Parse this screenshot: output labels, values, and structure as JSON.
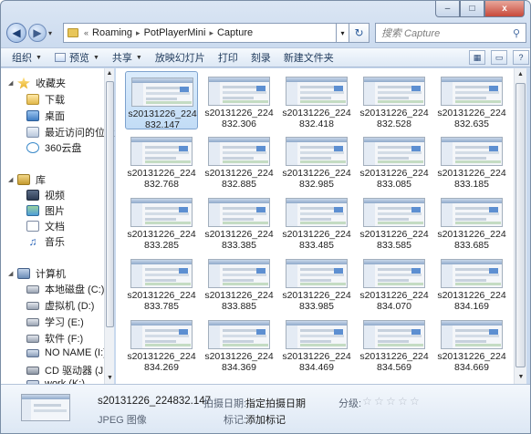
{
  "window": {
    "minimize": "–",
    "maximize": "□",
    "close": "x"
  },
  "address": {
    "back": "◀",
    "forward": "▶",
    "prefix": "«",
    "crumbs": [
      "Roaming",
      "PotPlayerMini",
      "Capture"
    ],
    "dropdown": "▾",
    "refresh": "↻"
  },
  "search": {
    "placeholder": "搜索 Capture",
    "icon": "search-icon"
  },
  "toolbar": {
    "organize": "组织",
    "preview": "预览",
    "share": "共享",
    "slideshow": "放映幻灯片",
    "print": "打印",
    "burn": "刻录",
    "new_folder": "新建文件夹"
  },
  "nav": {
    "favorites": "收藏夹",
    "downloads": "下载",
    "desktop": "桌面",
    "recent": "最近访问的位置",
    "cloud": "360云盘",
    "libraries": "库",
    "videos": "视频",
    "pictures": "图片",
    "documents": "文档",
    "music": "音乐",
    "computer": "计算机",
    "drives": [
      "本地磁盘 (C:)",
      "虚拟机 (D:)",
      "学习 (E:)",
      "软件 (F:)",
      "NO NAME (I:)",
      "CD 驱动器 (J:)",
      "work (K:)"
    ]
  },
  "files": [
    [
      "s20131226_224",
      "832.147"
    ],
    [
      "s20131226_224",
      "832.306"
    ],
    [
      "s20131226_224",
      "832.418"
    ],
    [
      "s20131226_224",
      "832.528"
    ],
    [
      "s20131226_224",
      "832.635"
    ],
    [
      "s20131226_224",
      "832.768"
    ],
    [
      "s20131226_224",
      "832.885"
    ],
    [
      "s20131226_224",
      "832.985"
    ],
    [
      "s20131226_224",
      "833.085"
    ],
    [
      "s20131226_224",
      "833.185"
    ],
    [
      "s20131226_224",
      "833.285"
    ],
    [
      "s20131226_224",
      "833.385"
    ],
    [
      "s20131226_224",
      "833.485"
    ],
    [
      "s20131226_224",
      "833.585"
    ],
    [
      "s20131226_224",
      "833.685"
    ],
    [
      "s20131226_224",
      "833.785"
    ],
    [
      "s20131226_224",
      "833.885"
    ],
    [
      "s20131226_224",
      "833.985"
    ],
    [
      "s20131226_224",
      "834.070"
    ],
    [
      "s20131226_224",
      "834.169"
    ],
    [
      "s20131226_224",
      "834.269"
    ],
    [
      "s20131226_224",
      "834.369"
    ],
    [
      "s20131226_224",
      "834.469"
    ],
    [
      "s20131226_224",
      "834.569"
    ],
    [
      "s20131226_224",
      "834.669"
    ]
  ],
  "selected_index": 0,
  "details": {
    "name": "s20131226_224832.147",
    "type": "JPEG 图像",
    "date_label": "拍摄日期:",
    "date_value": "指定拍摄日期",
    "tags_label": "标记:",
    "tags_value": "添加标记",
    "rating_label": "分级:",
    "rating": 0,
    "rating_max": 5
  }
}
